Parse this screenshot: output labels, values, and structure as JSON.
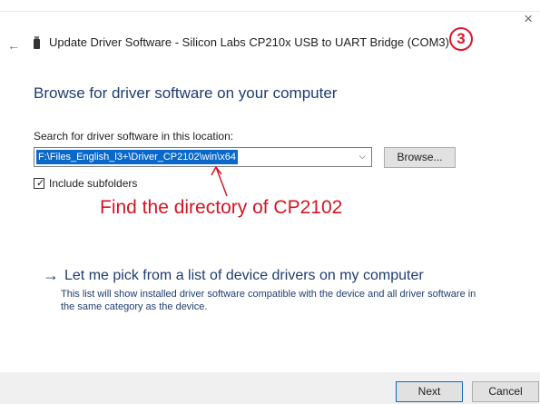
{
  "window": {
    "title": "Update Driver Software - Silicon Labs CP210x USB to UART Bridge (COM3)",
    "close_glyph": "×",
    "back_glyph": "←"
  },
  "step_marker": "3",
  "page": {
    "heading": "Browse for driver software on your computer",
    "search_label": "Search for driver software in this location:",
    "path_value": "F:\\Files_English_l3+\\Driver_CP2102\\win\\x64",
    "dropdown_glyph": "⌵",
    "browse_label": "Browse...",
    "include_subfolders_label": "Include subfolders",
    "include_subfolders_checked": true
  },
  "annotation": {
    "text": "Find the directory of CP2102",
    "color": "#d41424"
  },
  "pick_option": {
    "arrow_glyph": "→",
    "title": "Let me pick from a list of device drivers on my computer",
    "description": "This list will show installed driver software compatible with the device and all driver software in the same category as the device."
  },
  "footer": {
    "next_label": "Next",
    "cancel_label": "Cancel"
  },
  "colors": {
    "accent": "#0a68c9",
    "link_blue": "#1f3d71",
    "annotation_red": "#d41424"
  }
}
